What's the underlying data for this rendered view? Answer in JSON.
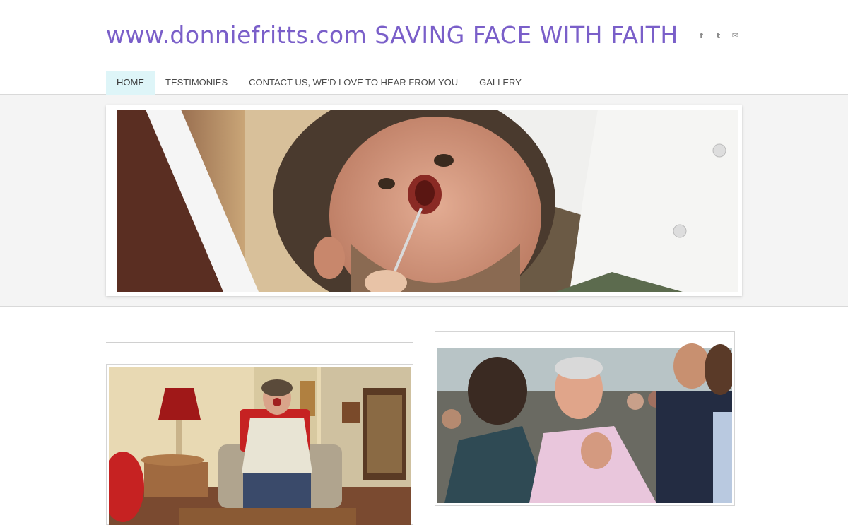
{
  "site": {
    "title": "www.donniefritts.com SAVING FACE WITH FAITH"
  },
  "social": [
    {
      "icon": "facebook-icon",
      "glyph": "f"
    },
    {
      "icon": "twitter-icon",
      "glyph": "t"
    },
    {
      "icon": "email-icon",
      "glyph": "✉"
    }
  ],
  "nav": {
    "items": [
      {
        "label": "HOME",
        "active": true
      },
      {
        "label": "TESTIMONIES",
        "active": false
      },
      {
        "label": "CONTACT US, WE'D LOVE TO HEAR FROM YOU",
        "active": false
      },
      {
        "label": "GALLERY",
        "active": false
      }
    ]
  },
  "colors": {
    "title": "#7a5fc9",
    "nav_active_bg": "#def5f8",
    "band_bg": "#f4f4f4"
  }
}
